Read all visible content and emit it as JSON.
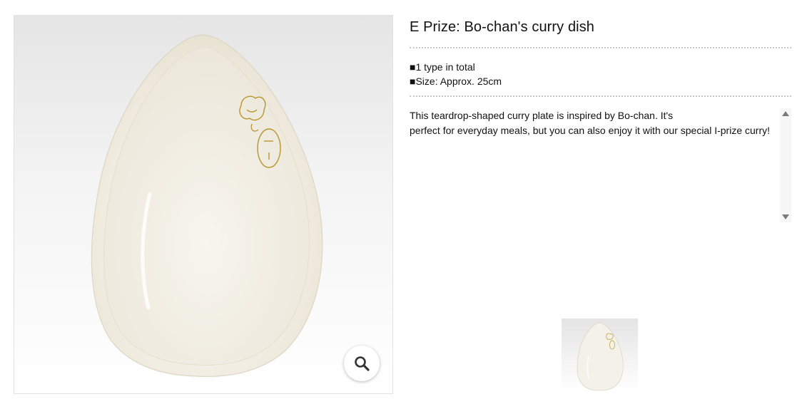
{
  "product": {
    "title": "E Prize: Bo-chan's curry dish",
    "specs": [
      "■1 type in total",
      "■Size: Approx. 25cm"
    ],
    "description_lines": [
      "This teardrop-shaped curry plate is inspired by Bo-chan. It's",
      "perfect for everyday meals, but you can also enjoy it with our special I-prize curry!"
    ]
  },
  "icons": {
    "zoom": "magnifier-icon",
    "scroll_up": "triangle-up-icon",
    "scroll_down": "triangle-down-icon"
  },
  "colors": {
    "plate": "#f6f3ea",
    "gold_print": "#b8962e",
    "divider": "#c8c8c8"
  }
}
